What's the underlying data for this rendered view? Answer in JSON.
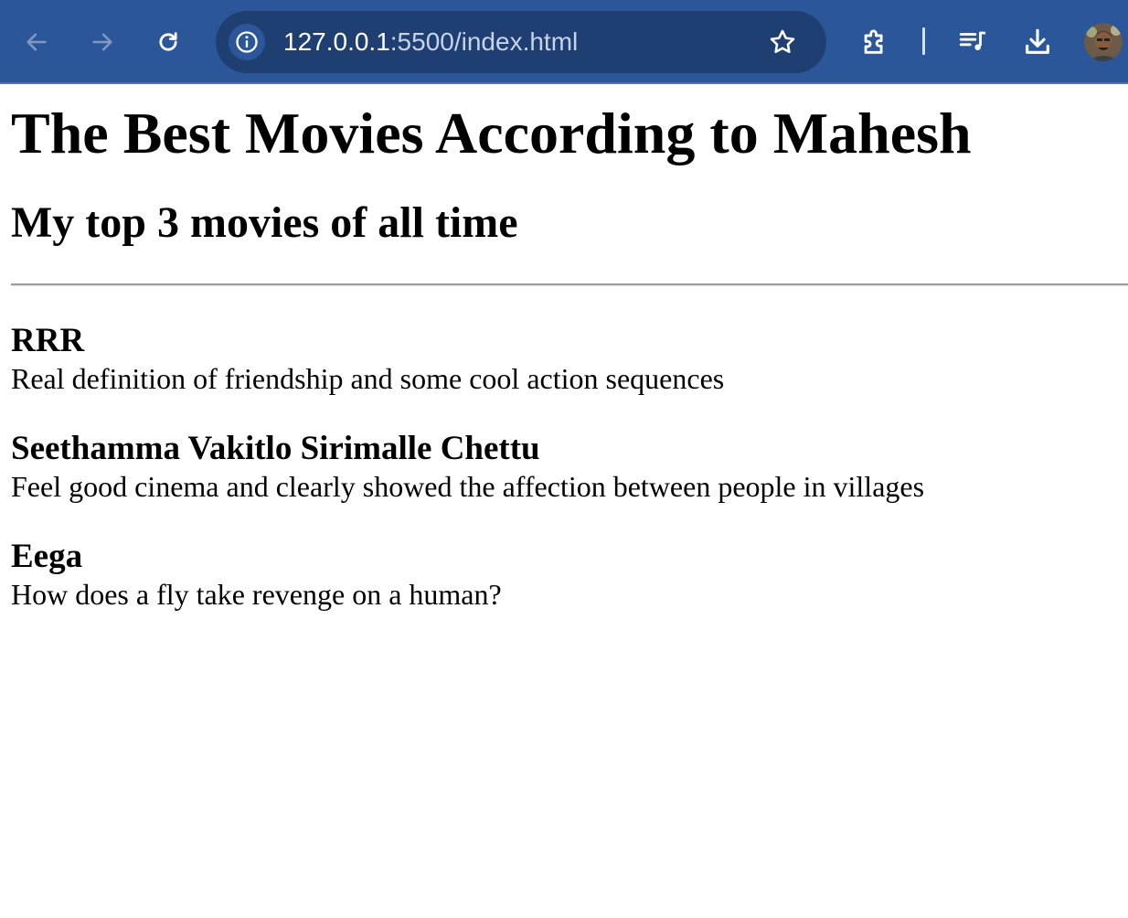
{
  "browser": {
    "url_host": "127.0.0.1",
    "url_path": ":5500/index.html",
    "icons": {
      "back": "arrow-left-icon",
      "forward": "arrow-right-icon",
      "reload": "reload-icon",
      "site_info": "info-icon",
      "bookmark": "star-icon",
      "extensions": "puzzle-icon",
      "media": "playlist-music-icon",
      "downloads": "download-icon",
      "profile": "avatar"
    },
    "colors": {
      "toolbar": "#2b579a",
      "omnibox": "#1f3f73"
    }
  },
  "page": {
    "title": "The Best Movies According to Mahesh",
    "subtitle": "My top 3 movies of all time",
    "movies": [
      {
        "title": "RRR",
        "description": "Real definition of friendship and some cool action sequences"
      },
      {
        "title": "Seethamma Vakitlo Sirimalle Chettu",
        "description": "Feel good cinema and clearly showed the affection between people in villages"
      },
      {
        "title": "Eega",
        "description": "How does a fly take revenge on a human?"
      }
    ]
  }
}
